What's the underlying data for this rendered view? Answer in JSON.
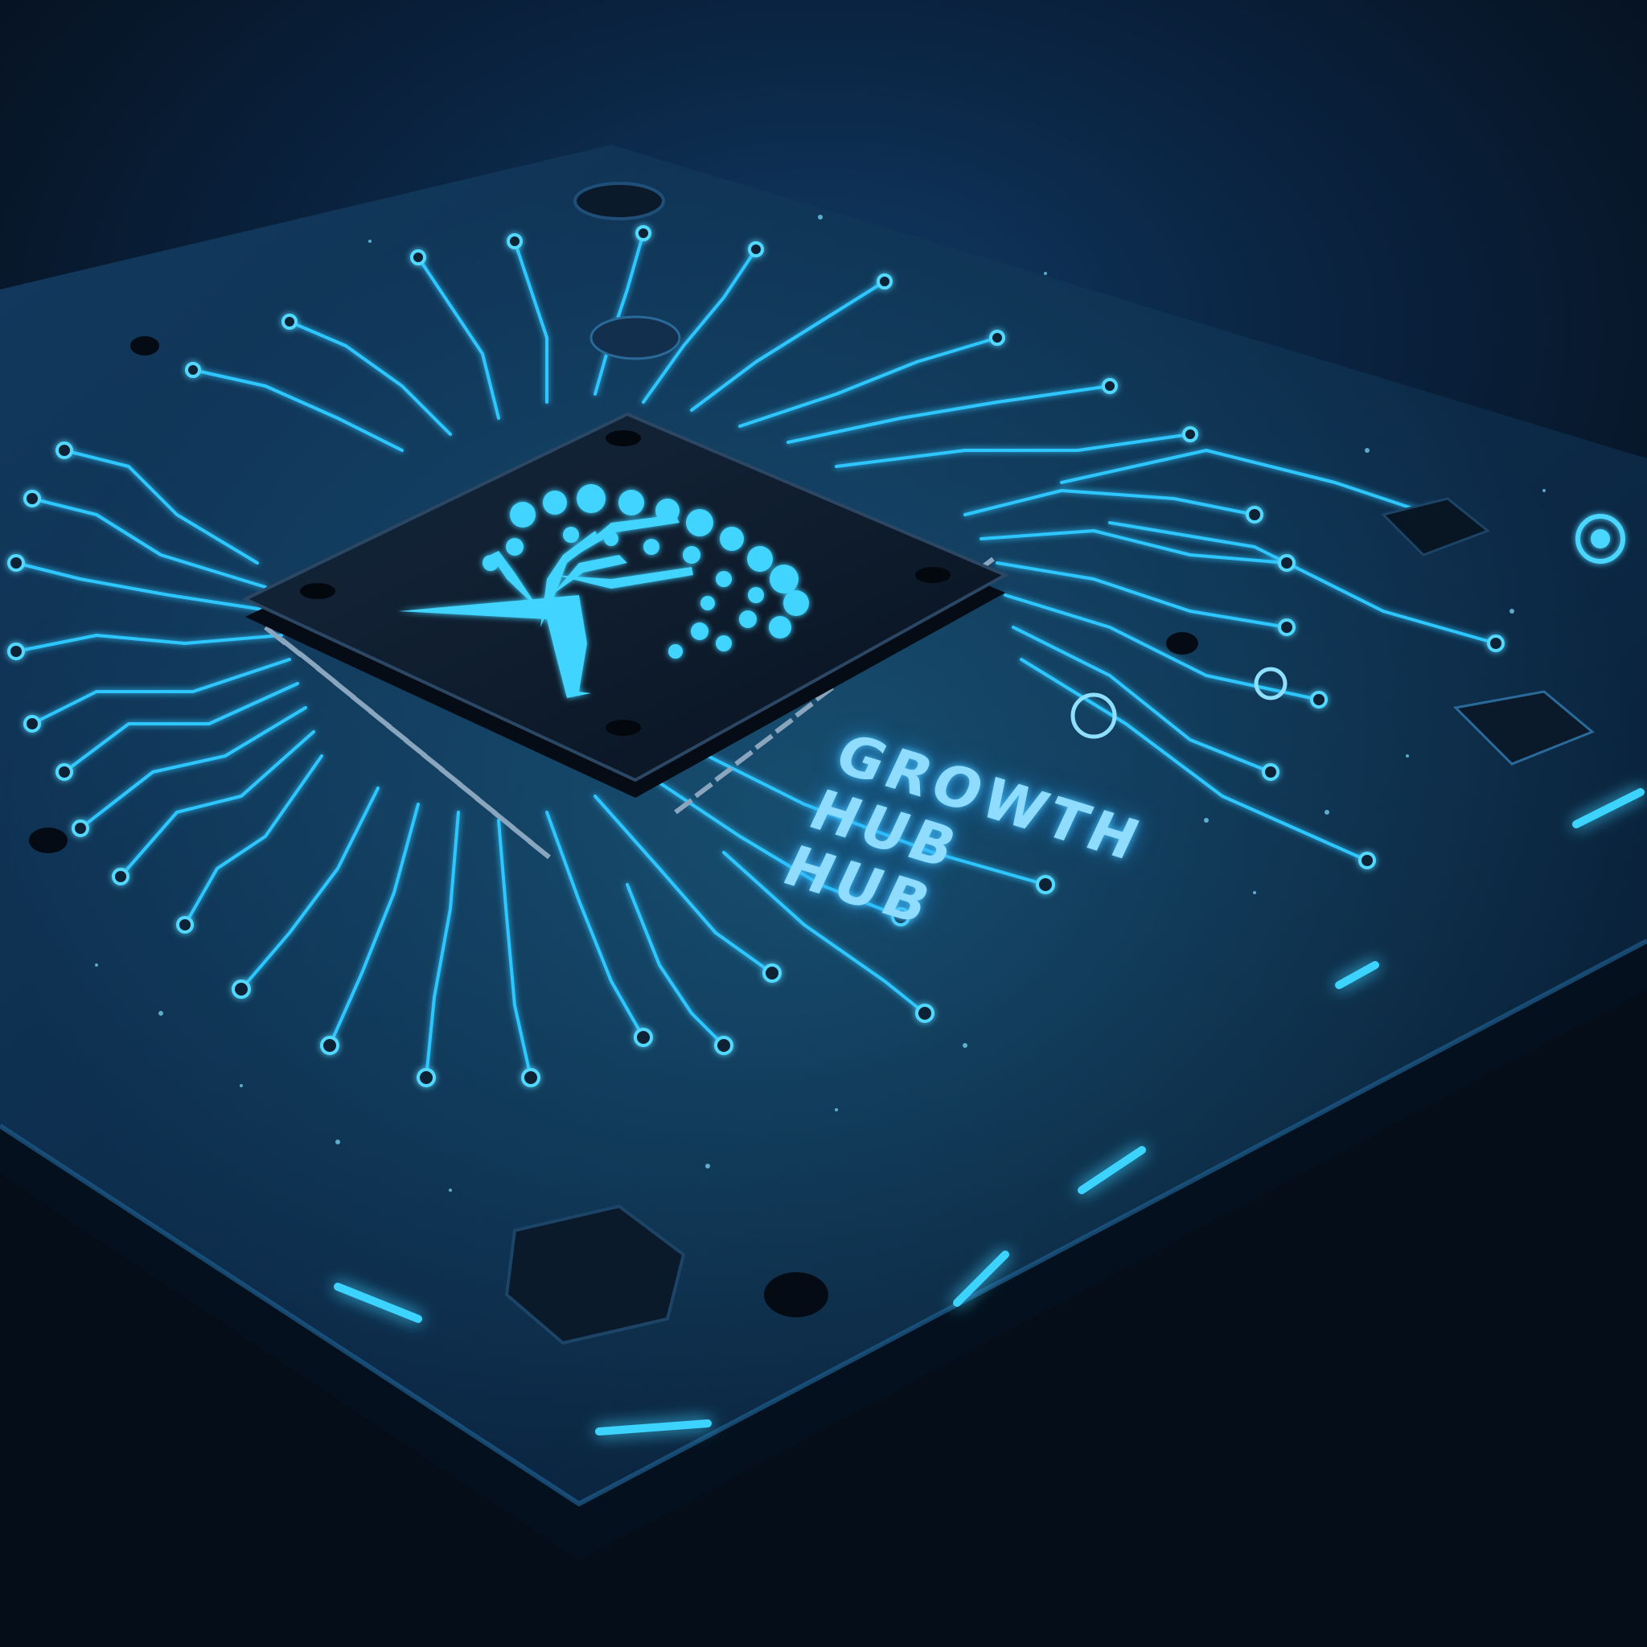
{
  "image": {
    "subject": "circuit-board",
    "engraved_text": [
      "GROWTH",
      "HUB",
      "HUB"
    ],
    "chip_logo_icon": "tree-icon",
    "colors": {
      "background_top": "#103a63",
      "background_bottom": "#050d18",
      "board": "#0d2a47",
      "chip": "#0b1a2c",
      "trace_glow": "#2fc6ff",
      "logo": "#41d4ff"
    }
  }
}
